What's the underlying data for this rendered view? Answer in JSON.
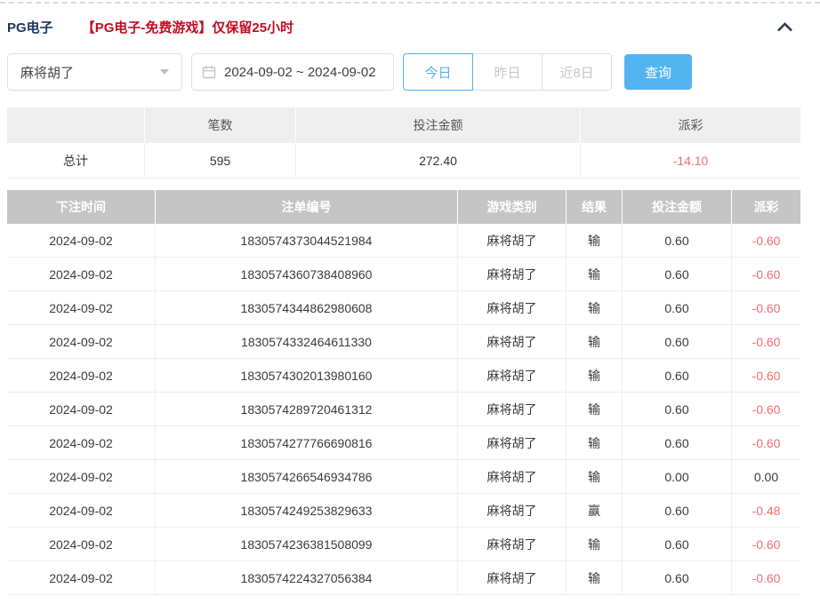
{
  "header": {
    "title": "PG电子",
    "notice": "【PG电子-免费游戏】仅保留25小时"
  },
  "filters": {
    "game_select": {
      "value": "麻将胡了"
    },
    "date_range": {
      "value": "2024-09-02 ~ 2024-09-02"
    },
    "quick_buttons": [
      {
        "label": "今日",
        "active": true
      },
      {
        "label": "昨日",
        "active": false
      },
      {
        "label": "近8日",
        "active": false
      }
    ],
    "search_label": "查询"
  },
  "summary": {
    "headers": [
      "",
      "笔数",
      "投注金额",
      "派彩"
    ],
    "row": {
      "label": "总计",
      "count": "595",
      "bet_amount": "272.40",
      "payout": "-14.10"
    }
  },
  "table": {
    "headers": [
      "下注时间",
      "注单编号",
      "游戏类别",
      "结果",
      "投注金额",
      "派彩"
    ],
    "rows": [
      {
        "date": "2024-09-02",
        "bet_id": "1830574373044521984",
        "game": "麻将胡了",
        "result": "输",
        "amount": "0.60",
        "payout": "-0.60"
      },
      {
        "date": "2024-09-02",
        "bet_id": "1830574360738408960",
        "game": "麻将胡了",
        "result": "输",
        "amount": "0.60",
        "payout": "-0.60"
      },
      {
        "date": "2024-09-02",
        "bet_id": "1830574344862980608",
        "game": "麻将胡了",
        "result": "输",
        "amount": "0.60",
        "payout": "-0.60"
      },
      {
        "date": "2024-09-02",
        "bet_id": "1830574332464611330",
        "game": "麻将胡了",
        "result": "输",
        "amount": "0.60",
        "payout": "-0.60"
      },
      {
        "date": "2024-09-02",
        "bet_id": "1830574302013980160",
        "game": "麻将胡了",
        "result": "输",
        "amount": "0.60",
        "payout": "-0.60"
      },
      {
        "date": "2024-09-02",
        "bet_id": "1830574289720461312",
        "game": "麻将胡了",
        "result": "输",
        "amount": "0.60",
        "payout": "-0.60"
      },
      {
        "date": "2024-09-02",
        "bet_id": "1830574277766690816",
        "game": "麻将胡了",
        "result": "输",
        "amount": "0.60",
        "payout": "-0.60"
      },
      {
        "date": "2024-09-02",
        "bet_id": "1830574266546934786",
        "game": "麻将胡了",
        "result": "输",
        "amount": "0.00",
        "payout": "0.00"
      },
      {
        "date": "2024-09-02",
        "bet_id": "1830574249253829633",
        "game": "麻将胡了",
        "result": "赢",
        "amount": "0.60",
        "payout": "-0.48"
      },
      {
        "date": "2024-09-02",
        "bet_id": "1830574236381508099",
        "game": "麻将胡了",
        "result": "输",
        "amount": "0.60",
        "payout": "-0.60"
      },
      {
        "date": "2024-09-02",
        "bet_id": "1830574224327056384",
        "game": "麻将胡了",
        "result": "输",
        "amount": "0.60",
        "payout": "-0.60"
      }
    ]
  },
  "colors": {
    "accent_blue": "#54b4f0",
    "active_tab_blue": "#53aef0",
    "danger_red": "#f56c6c",
    "notice_red": "#c30d23",
    "title_navy": "#1f3864",
    "table_header_gray": "#c5c5c5",
    "summary_header_gray": "#efefef"
  }
}
